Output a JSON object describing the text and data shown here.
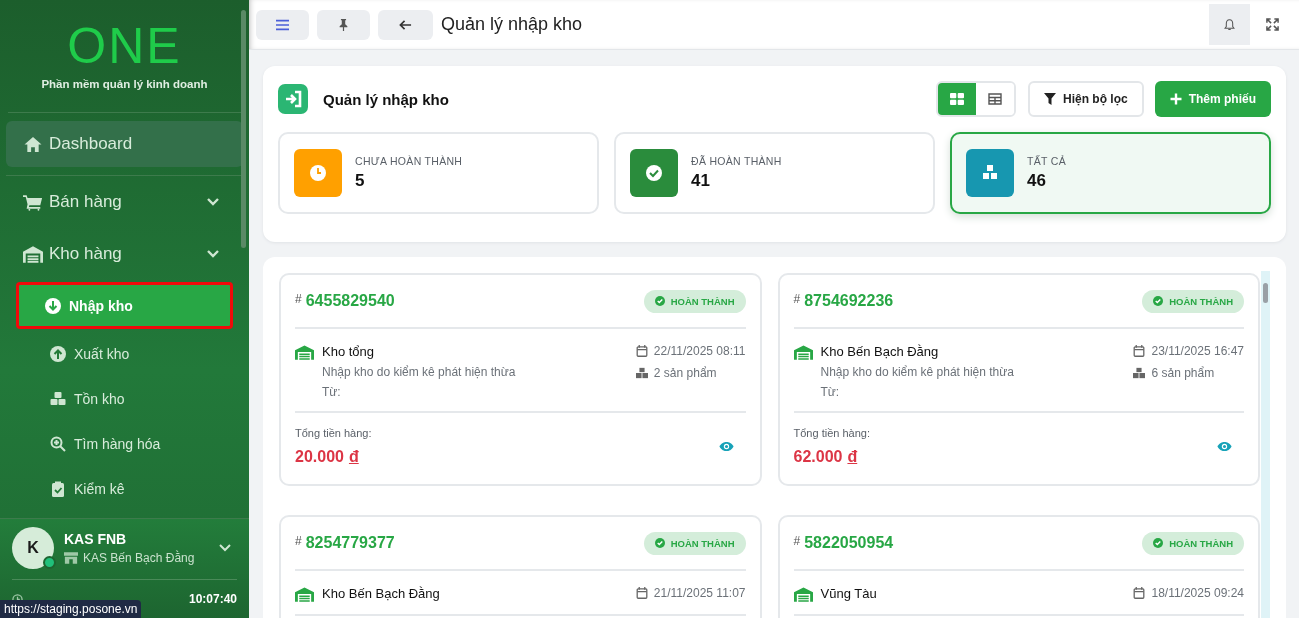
{
  "sidebar": {
    "logo": "ONE",
    "tagline": "Phần mềm quản lý kinh doanh",
    "menu": [
      {
        "kind": "link",
        "label": "Dashboard"
      },
      {
        "kind": "group",
        "label": "Bán hàng"
      },
      {
        "kind": "group",
        "label": "Kho hàng",
        "children": [
          {
            "label": "Nhập kho",
            "selected": true
          },
          {
            "label": "Xuất kho",
            "selected": false
          },
          {
            "label": "Tồn kho",
            "selected": false
          },
          {
            "label": "Tìm hàng hóa",
            "selected": false
          },
          {
            "label": "Kiểm kê",
            "selected": false
          }
        ]
      }
    ],
    "user": {
      "initial": "K",
      "name": "KAS FNB",
      "store": "KAS Bến Bạch Đằng",
      "online": true
    },
    "system_time": {
      "value": "10:07:40"
    }
  },
  "status_url": "https://staging.posone.vn",
  "topbar": {
    "title": "Quản lý nhập kho"
  },
  "panel": {
    "title": "Quản lý nhập kho",
    "view_modes": [
      {
        "selected": true
      },
      {
        "selected": false
      }
    ],
    "filter_button": "Hiện bộ lọc",
    "add_button": "Thêm phiếu",
    "stats": [
      {
        "label": "CHƯA HOÀN THÀNH",
        "value": "5",
        "color": "#ffa000",
        "selected": false
      },
      {
        "label": "ĐÃ HOÀN THÀNH",
        "value": "41",
        "color": "#2a8c3c",
        "selected": false
      },
      {
        "label": "TẤT CẢ",
        "value": "46",
        "color": "#1797b0",
        "selected": true
      }
    ]
  },
  "receipts": [
    {
      "prefix": "#",
      "code": "6455829540",
      "status": "HOÀN THÀNH",
      "warehouse": "Kho tổng",
      "date": "22/11/2025 08:11",
      "note": "Nhập kho do kiểm kê phát hiện thừa",
      "products": "2 sản phẩm",
      "from": "Từ:",
      "total_label": "Tổng tiền hàng:",
      "total": "20.000",
      "currency": "đ"
    },
    {
      "prefix": "#",
      "code": "8754692236",
      "status": "HOÀN THÀNH",
      "warehouse": "Kho Bến Bạch Đằng",
      "date": "23/11/2025 16:47",
      "note": "Nhập kho do kiểm kê phát hiện thừa",
      "products": "6 sản phẩm",
      "from": "Từ:",
      "total_label": "Tổng tiền hàng:",
      "total": "62.000",
      "currency": "đ"
    },
    {
      "prefix": "#",
      "code": "8254779377",
      "status": "HOÀN THÀNH",
      "warehouse": "Kho Bến Bạch Đằng",
      "date": "21/11/2025 11:07"
    },
    {
      "prefix": "#",
      "code": "5822050954",
      "status": "HOÀN THÀNH",
      "warehouse": "Vũng Tàu",
      "date": "18/11/2025 09:24"
    }
  ]
}
